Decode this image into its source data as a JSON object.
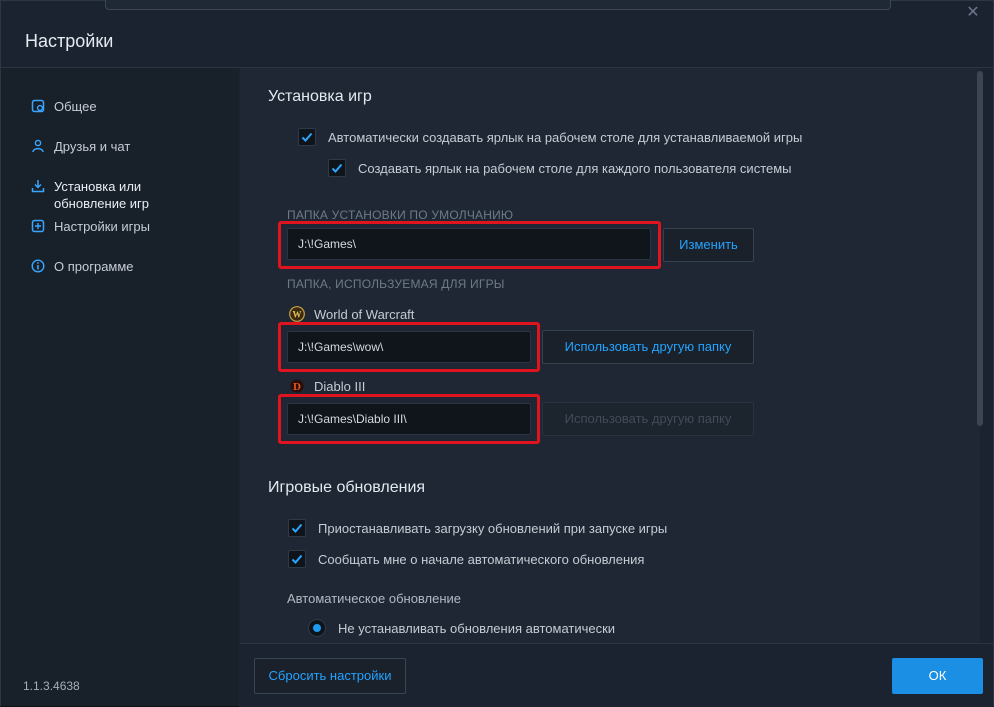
{
  "window": {
    "title": "Настройки",
    "close_glyph": "✕"
  },
  "sidebar": {
    "items": [
      {
        "label": "Общее",
        "icon": "gear-icon"
      },
      {
        "label": "Друзья и чат",
        "icon": "friends-icon"
      },
      {
        "label": "Установка или\nобновление игр",
        "icon": "download-icon",
        "active": true
      },
      {
        "label": "Настройки игры",
        "icon": "game-settings-icon"
      },
      {
        "label": "О программе",
        "icon": "info-icon"
      }
    ],
    "version": "1.1.3.4638"
  },
  "install": {
    "title": "Установка игр",
    "shortcut_label": "Автоматически создавать ярлык на рабочем столе для устанавливаемой игры",
    "shortcut_checked": true,
    "per_user_label": "Создавать ярлык на рабочем столе для каждого пользователя системы",
    "per_user_checked": true,
    "default_folder_caption": "ПАПКА УСТАНОВКИ ПО УМОЛЧАНИЮ",
    "default_folder_value": "J:\\!Games\\",
    "change_button": "Изменить",
    "game_folder_caption": "ПАПКА, ИСПОЛЬЗУЕМАЯ ДЛЯ ИГРЫ",
    "games": [
      {
        "name": "World of Warcraft",
        "icon": "wow-icon",
        "path": "J:\\!Games\\wow\\",
        "button": "Использовать другую папку",
        "button_enabled": true
      },
      {
        "name": "Diablo III",
        "icon": "diablo-icon",
        "path": "J:\\!Games\\Diablo III\\",
        "button": "Использовать другую папку",
        "button_enabled": false
      }
    ]
  },
  "updates": {
    "title": "Игровые обновления",
    "pause_label": "Приостанавливать загрузку обновлений при запуске игры",
    "pause_checked": true,
    "notify_label": "Сообщать мне о начале автоматического обновления",
    "notify_checked": true,
    "auto_update_label": "Автоматическое обновление",
    "auto_option_label": "Не устанавливать обновления автоматически",
    "auto_option_selected": true
  },
  "footer": {
    "reset_button": "Сбросить настройки",
    "ok_button": "ОК"
  },
  "colors": {
    "accent": "#1a8fe3",
    "link": "#23a3ff",
    "highlight": "#e0141f"
  }
}
